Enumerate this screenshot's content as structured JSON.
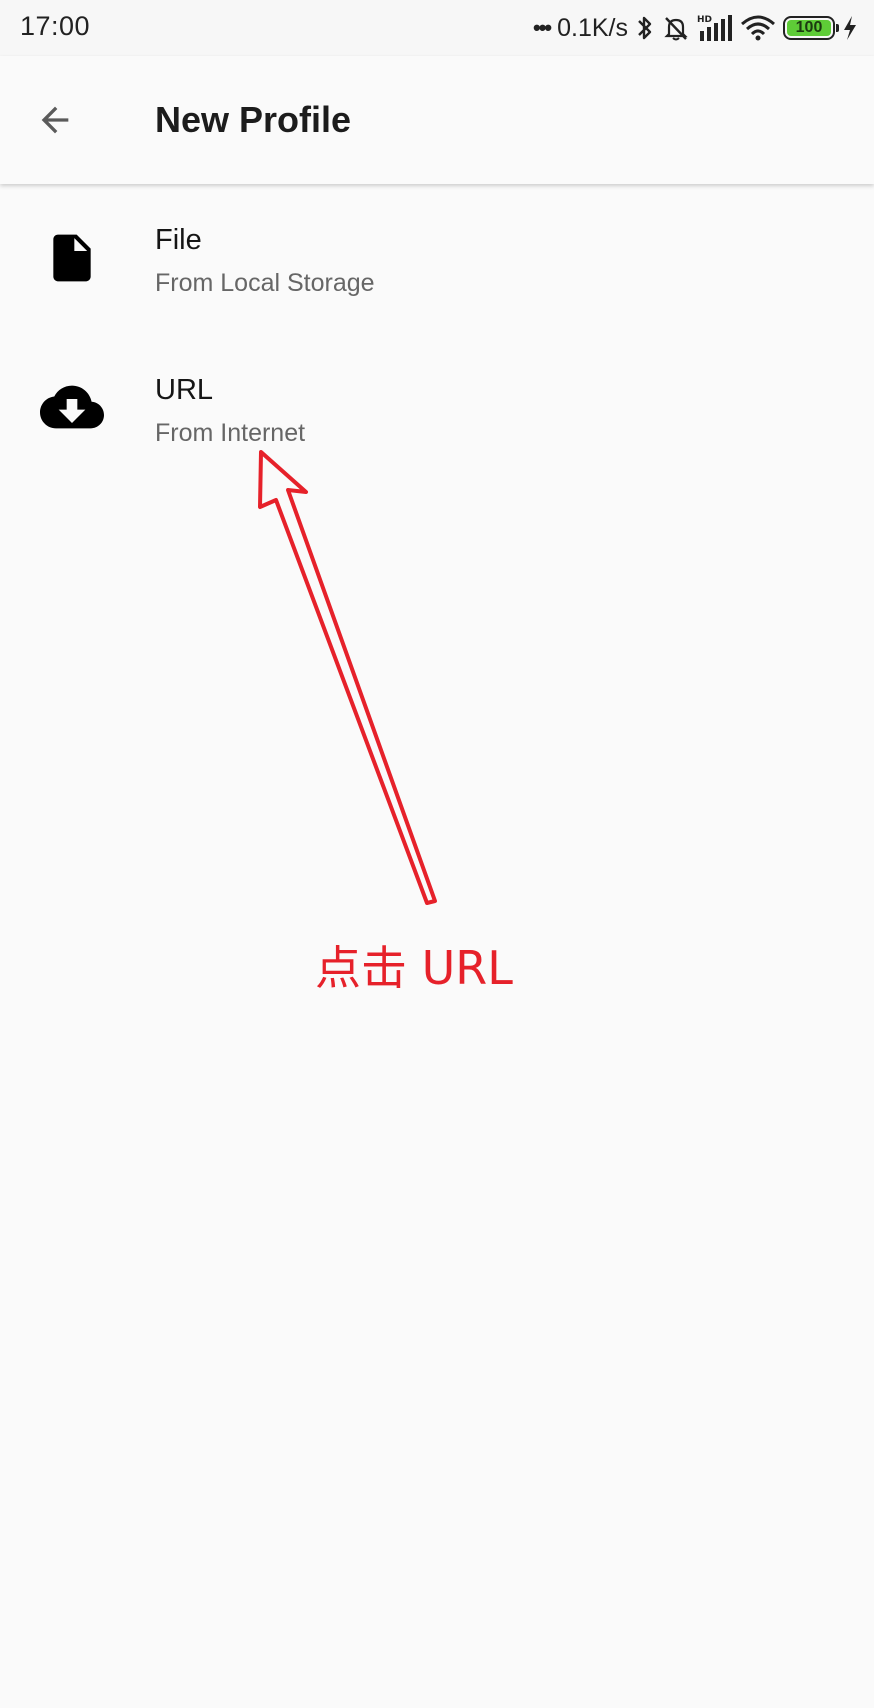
{
  "status_bar": {
    "time": "17:00",
    "dots": "•••",
    "net_speed": "0.1K/s",
    "battery_level": "100",
    "icons": [
      "bluetooth-icon",
      "mute-bell-icon",
      "hd-signal-icon",
      "wifi-icon",
      "battery-icon",
      "charging-icon"
    ],
    "battery_color": "#5ecc37"
  },
  "app_bar": {
    "back_icon": "arrow-back-icon",
    "title": "New Profile"
  },
  "options": [
    {
      "icon": "file-icon",
      "title": "File",
      "subtitle": "From Local Storage"
    },
    {
      "icon": "cloud-download-icon",
      "title": "URL",
      "subtitle": "From Internet"
    }
  ],
  "annotation": {
    "label": "点击 URL",
    "color": "#e6212a"
  }
}
